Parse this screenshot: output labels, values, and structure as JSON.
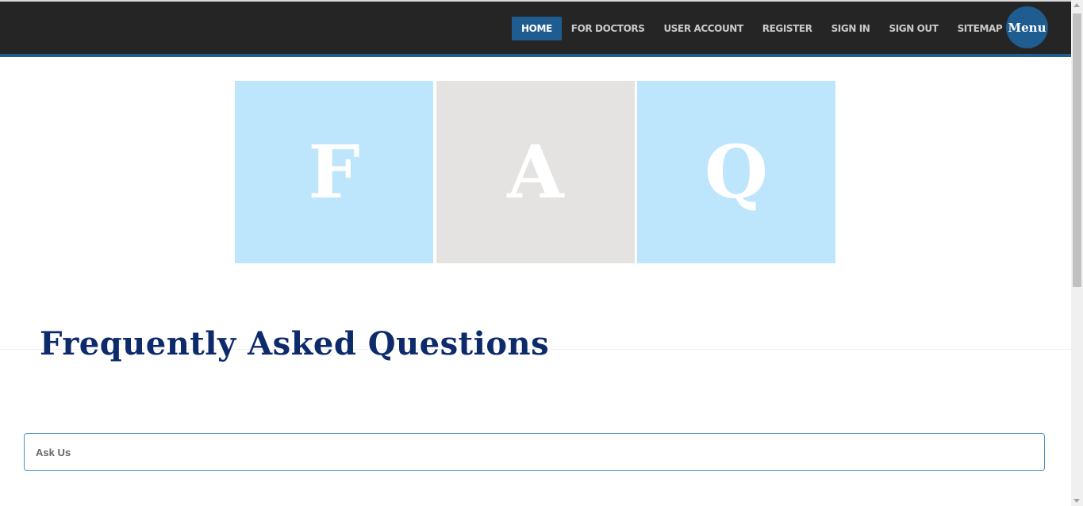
{
  "nav": {
    "items": [
      {
        "label": "HOME",
        "active": true
      },
      {
        "label": "FOR DOCTORS",
        "active": false
      },
      {
        "label": "USER ACCOUNT",
        "active": false
      },
      {
        "label": "REGISTER",
        "active": false
      },
      {
        "label": "SIGN IN",
        "active": false
      },
      {
        "label": "SIGN OUT",
        "active": false
      },
      {
        "label": "SITEMAP",
        "active": false
      }
    ],
    "menu_label": "Menu"
  },
  "banner": {
    "letters": [
      "F",
      "A",
      "Q"
    ]
  },
  "main": {
    "title": "Frequently Asked Questions",
    "ask_label": "Ask Us"
  },
  "colors": {
    "header_bg": "#252525",
    "accent": "#1f5c8f",
    "tile_blue": "#bde5fb",
    "tile_gray": "#e4e3e1",
    "title": "#0d2a6b"
  }
}
